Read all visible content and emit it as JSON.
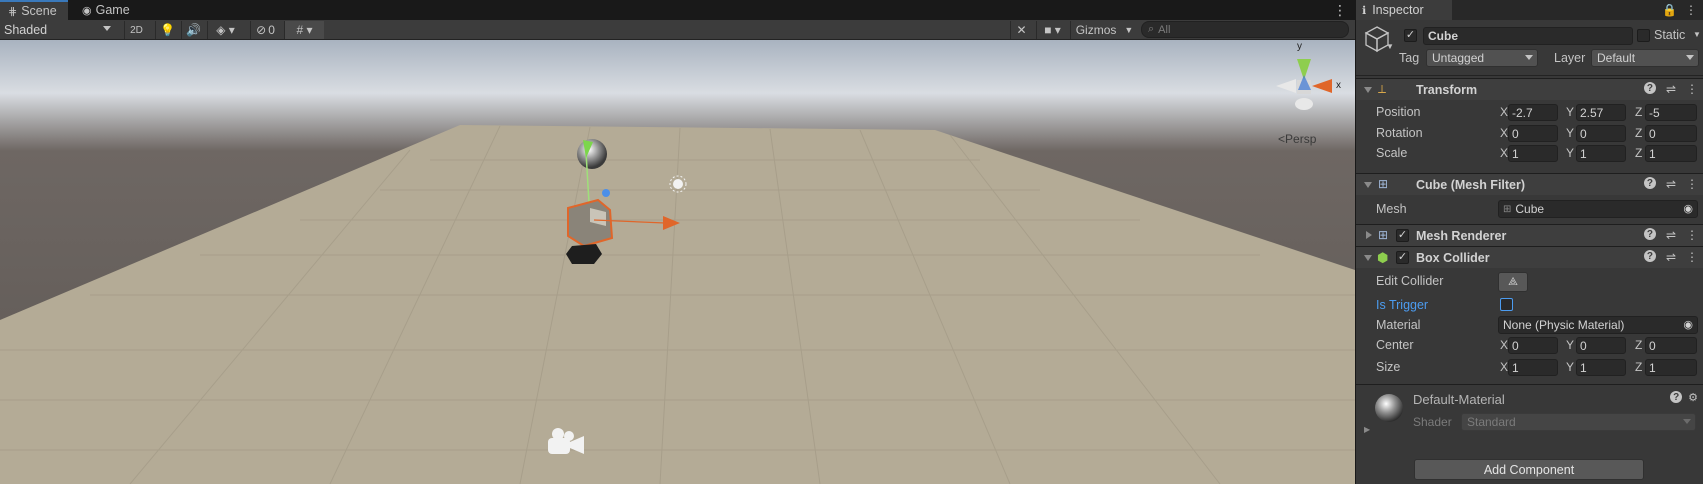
{
  "scene_tabs": {
    "scene": "Scene",
    "game": "Game"
  },
  "scene_toolbar": {
    "shading_mode": "Shaded",
    "mode_2d": "2D",
    "hidden_objects_count": "0",
    "gizmos": "Gizmos",
    "search_placeholder": "All"
  },
  "scene_view": {
    "projection_label": "Persp",
    "axis_x": "x",
    "axis_y": "y"
  },
  "inspector": {
    "tab_label": "Inspector",
    "gameobject": {
      "name": "Cube",
      "active": true,
      "static_label": "Static",
      "tag_label": "Tag",
      "tag_value": "Untagged",
      "layer_label": "Layer",
      "layer_value": "Default"
    },
    "transform": {
      "title": "Transform",
      "position_label": "Position",
      "rotation_label": "Rotation",
      "scale_label": "Scale",
      "position": {
        "x": "-2.7",
        "y": "2.57",
        "z": "-5"
      },
      "rotation": {
        "x": "0",
        "y": "0",
        "z": "0"
      },
      "scale": {
        "x": "1",
        "y": "1",
        "z": "1"
      }
    },
    "mesh_filter": {
      "title": "Cube (Mesh Filter)",
      "mesh_label": "Mesh",
      "mesh_value": "Cube"
    },
    "mesh_renderer": {
      "title": "Mesh Renderer",
      "enabled": true
    },
    "box_collider": {
      "title": "Box Collider",
      "enabled": true,
      "edit_collider_label": "Edit Collider",
      "is_trigger_label": "Is Trigger",
      "is_trigger": false,
      "material_label": "Material",
      "material_value": "None (Physic Material)",
      "center_label": "Center",
      "size_label": "Size",
      "center": {
        "x": "0",
        "y": "0",
        "z": "0"
      },
      "size": {
        "x": "1",
        "y": "1",
        "z": "1"
      }
    },
    "material": {
      "name": "Default-Material",
      "shader_label": "Shader",
      "shader_value": "Standard"
    },
    "add_component_label": "Add Component"
  },
  "axis_letters": {
    "x": "X",
    "y": "Y",
    "z": "Z"
  },
  "colors": {
    "accent_blue": "#3a79bb",
    "selection_orange": "#e0662a",
    "link_blue": "#4c9cf0"
  }
}
